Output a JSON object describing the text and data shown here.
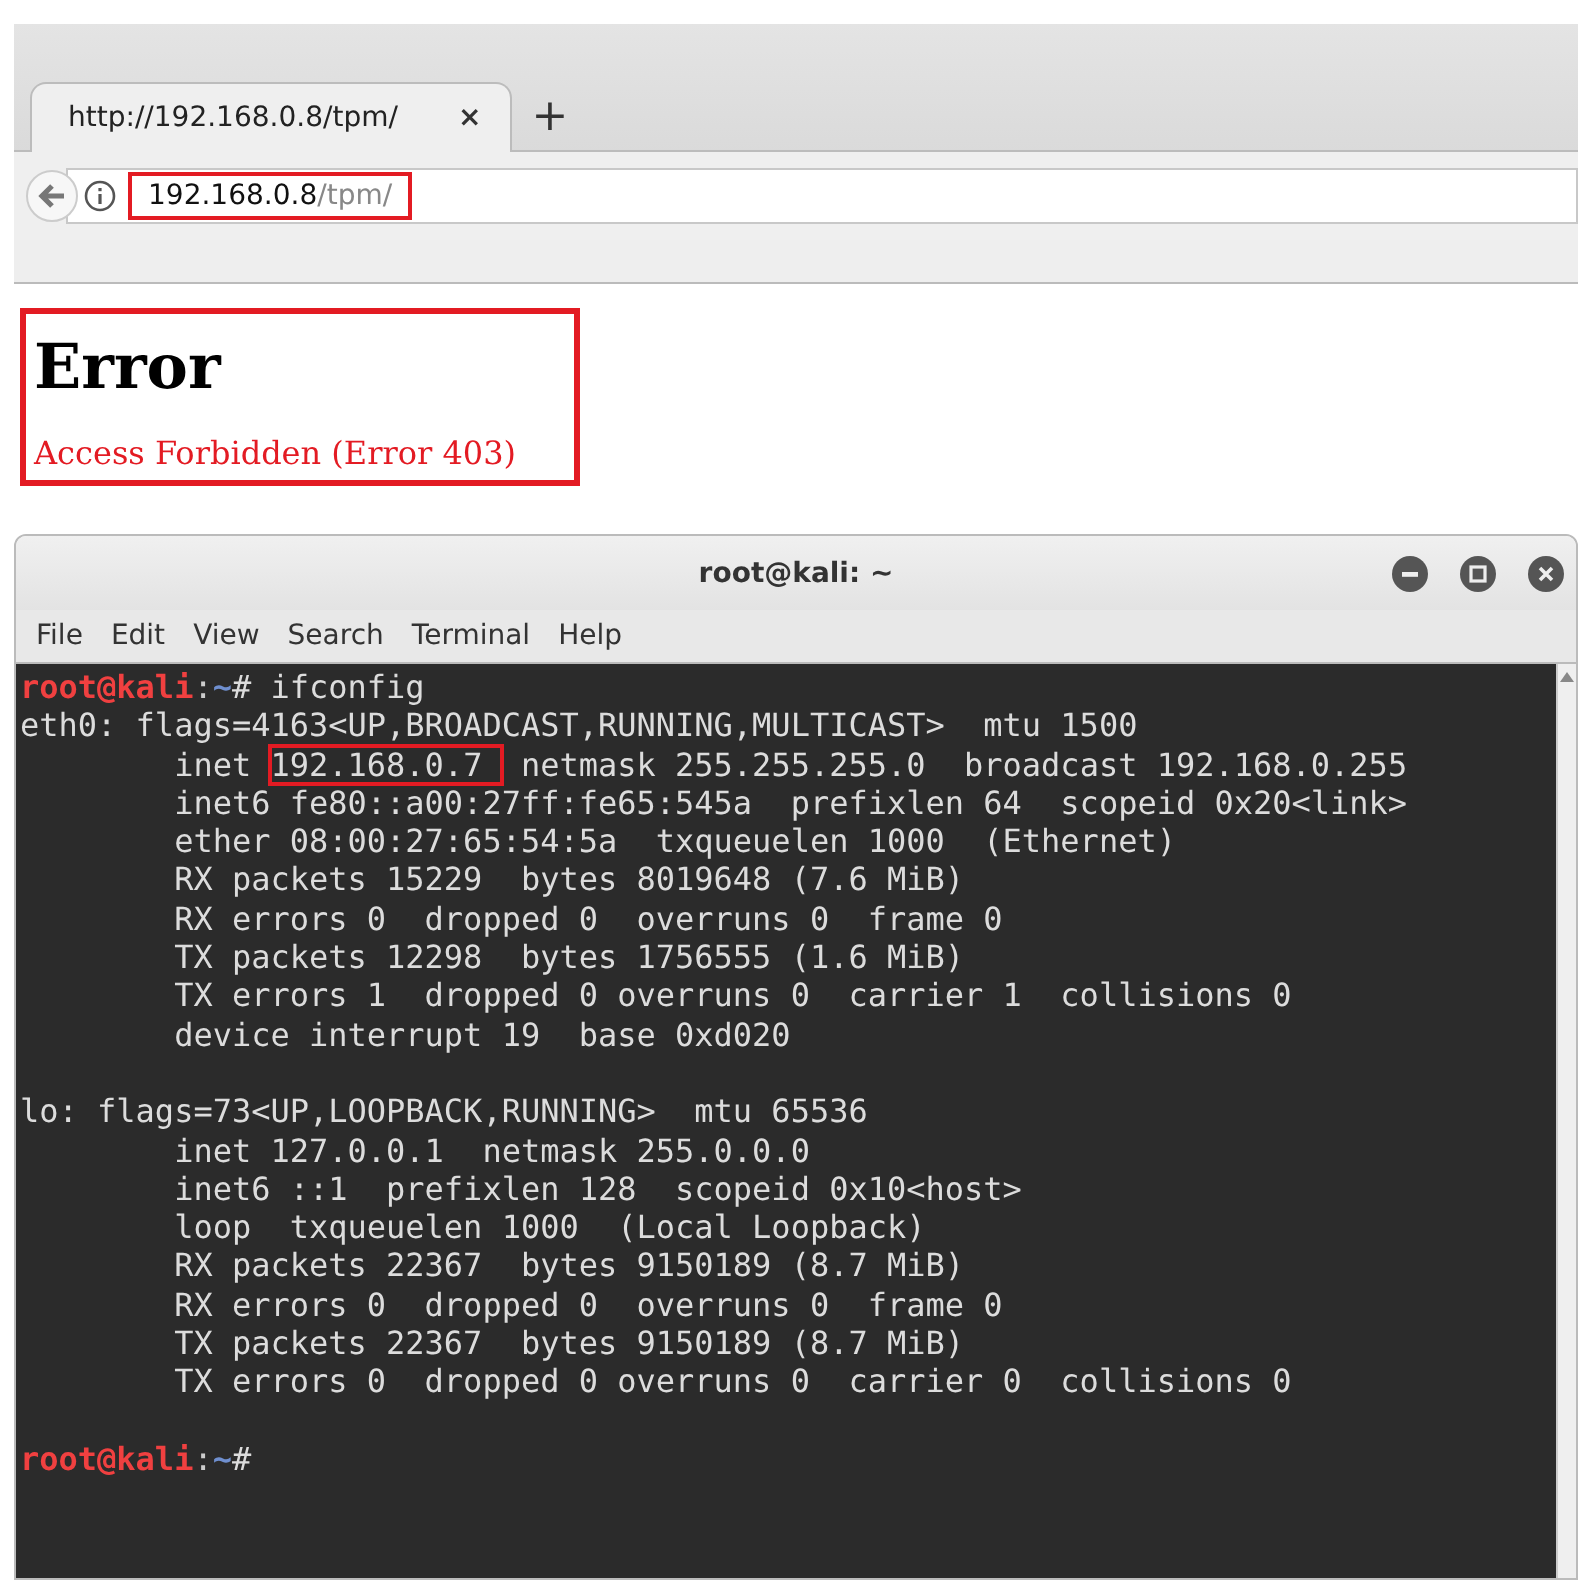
{
  "browser": {
    "tab": {
      "title": "http://192.168.0.8/tpm/",
      "selected": true,
      "close": "×"
    },
    "new_tab": "+",
    "address": {
      "host": "192.168.0.8",
      "path": "/tpm/",
      "highlighted": true
    }
  },
  "page": {
    "heading": "Error",
    "message": "Access Forbidden (Error 403)",
    "highlighted": true
  },
  "terminal": {
    "title": "root@kali: ~",
    "menu": [
      "File",
      "Edit",
      "View",
      "Search",
      "Terminal",
      "Help"
    ],
    "lines": [
      {
        "kind": "text",
        "parts": [
          {
            "kind": "user",
            "text": "root@kali"
          },
          {
            "kind": "sep",
            "text": ":"
          },
          {
            "kind": "path",
            "text": "~"
          },
          {
            "kind": "plain",
            "text": "# ifconfig"
          }
        ]
      },
      {
        "kind": "text",
        "parts": [
          {
            "kind": "plain",
            "text": "eth0: flags=4163<UP,BROADCAST,RUNNING,MULTICAST>  mtu 1500"
          }
        ]
      },
      {
        "kind": "text",
        "parts": [
          {
            "kind": "plain",
            "text": "        inet "
          },
          {
            "kind": "boxed",
            "text": "192.168.0.7 "
          },
          {
            "kind": "plain",
            "text": " netmask 255.255.255.0  broadcast 192.168.0.255"
          }
        ]
      },
      {
        "kind": "text",
        "parts": [
          {
            "kind": "plain",
            "text": "        inet6 fe80::a00:27ff:fe65:545a  prefixlen 64  scopeid 0x20<link>"
          }
        ]
      },
      {
        "kind": "text",
        "parts": [
          {
            "kind": "plain",
            "text": "        ether 08:00:27:65:54:5a  txqueuelen 1000  (Ethernet)"
          }
        ]
      },
      {
        "kind": "text",
        "parts": [
          {
            "kind": "plain",
            "text": "        RX packets 15229  bytes 8019648 (7.6 MiB)"
          }
        ]
      },
      {
        "kind": "text",
        "parts": [
          {
            "kind": "plain",
            "text": "        RX errors 0  dropped 0  overruns 0  frame 0"
          }
        ]
      },
      {
        "kind": "text",
        "parts": [
          {
            "kind": "plain",
            "text": "        TX packets 12298  bytes 1756555 (1.6 MiB)"
          }
        ]
      },
      {
        "kind": "text",
        "parts": [
          {
            "kind": "plain",
            "text": "        TX errors 1  dropped 0 overruns 0  carrier 1  collisions 0"
          }
        ]
      },
      {
        "kind": "text",
        "parts": [
          {
            "kind": "plain",
            "text": "        device interrupt 19  base 0xd020"
          }
        ]
      },
      {
        "kind": "blank"
      },
      {
        "kind": "text",
        "parts": [
          {
            "kind": "plain",
            "text": "lo: flags=73<UP,LOOPBACK,RUNNING>  mtu 65536"
          }
        ]
      },
      {
        "kind": "text",
        "parts": [
          {
            "kind": "plain",
            "text": "        inet 127.0.0.1  netmask 255.0.0.0"
          }
        ]
      },
      {
        "kind": "text",
        "parts": [
          {
            "kind": "plain",
            "text": "        inet6 ::1  prefixlen 128  scopeid 0x10<host>"
          }
        ]
      },
      {
        "kind": "text",
        "parts": [
          {
            "kind": "plain",
            "text": "        loop  txqueuelen 1000  (Local Loopback)"
          }
        ]
      },
      {
        "kind": "text",
        "parts": [
          {
            "kind": "plain",
            "text": "        RX packets 22367  bytes 9150189 (8.7 MiB)"
          }
        ]
      },
      {
        "kind": "text",
        "parts": [
          {
            "kind": "plain",
            "text": "        RX errors 0  dropped 0  overruns 0  frame 0"
          }
        ]
      },
      {
        "kind": "text",
        "parts": [
          {
            "kind": "plain",
            "text": "        TX packets 22367  bytes 9150189 (8.7 MiB)"
          }
        ]
      },
      {
        "kind": "text",
        "parts": [
          {
            "kind": "plain",
            "text": "        TX errors 0  dropped 0 overruns 0  carrier 0  collisions 0"
          }
        ]
      },
      {
        "kind": "blank"
      },
      {
        "kind": "text",
        "parts": [
          {
            "kind": "user",
            "text": "root@kali"
          },
          {
            "kind": "sep",
            "text": ":"
          },
          {
            "kind": "path",
            "text": "~"
          },
          {
            "kind": "plain",
            "text": "# "
          }
        ]
      }
    ]
  }
}
